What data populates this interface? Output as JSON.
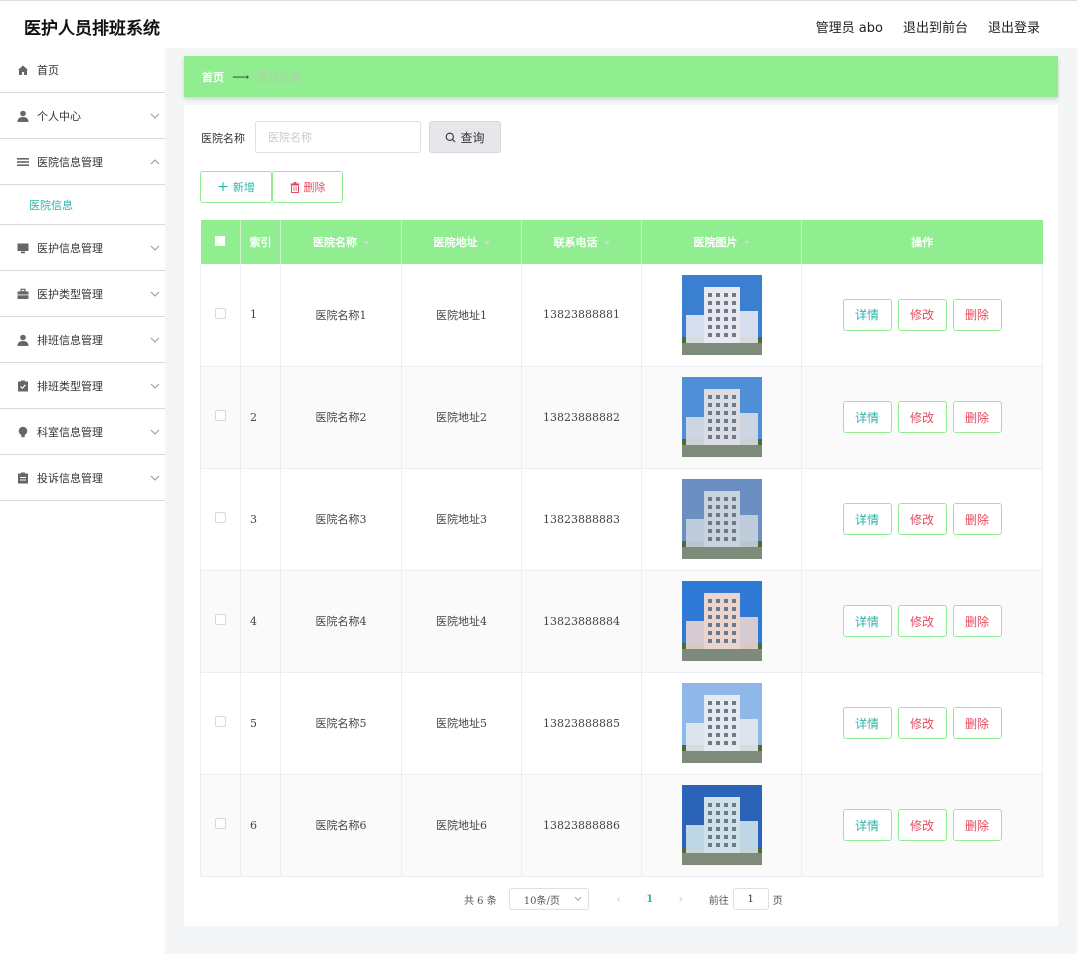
{
  "app": {
    "title": "医护人员排班系统"
  },
  "topbar": {
    "user_label": "管理员 abo",
    "front_label": "退出到前台",
    "logout_label": "退出登录"
  },
  "sidebar": {
    "home": "首页",
    "personal": "个人中心",
    "hospital_mgmt": "医院信息管理",
    "hospital_info": "医院信息",
    "nurse_mgmt": "医护信息管理",
    "nurse_type_mgmt": "医护类型管理",
    "schedule_mgmt": "排班信息管理",
    "schedule_type_mgmt": "排班类型管理",
    "dept_mgmt": "科室信息管理",
    "complaint_mgmt": "投诉信息管理"
  },
  "breadcrumb": {
    "home": "首页",
    "current": "医院信息"
  },
  "search": {
    "label": "医院名称",
    "placeholder": "医院名称",
    "value": "",
    "button": "查询"
  },
  "toolbar": {
    "add_label": "新增",
    "delete_label": "删除"
  },
  "table": {
    "headers": {
      "index": "索引",
      "name": "医院名称",
      "address": "医院地址",
      "phone": "联系电话",
      "photo": "医院图片",
      "actions": "操作"
    },
    "action_labels": {
      "detail": "详情",
      "edit": "修改",
      "delete": "删除"
    },
    "rows": [
      {
        "index": "1",
        "name": "医院名称1",
        "address": "医院地址1",
        "phone": "13823888881"
      },
      {
        "index": "2",
        "name": "医院名称2",
        "address": "医院地址2",
        "phone": "13823888882"
      },
      {
        "index": "3",
        "name": "医院名称3",
        "address": "医院地址3",
        "phone": "13823888883"
      },
      {
        "index": "4",
        "name": "医院名称4",
        "address": "医院地址4",
        "phone": "13823888884"
      },
      {
        "index": "5",
        "name": "医院名称5",
        "address": "医院地址5",
        "phone": "13823888885"
      },
      {
        "index": "6",
        "name": "医院名称6",
        "address": "医院地址6",
        "phone": "13823888886"
      }
    ]
  },
  "pagination": {
    "total": "共 6 条",
    "page_size": "10条/页",
    "current_page": "1",
    "goto_label": "前往",
    "goto_value": "1",
    "page_suffix": "页"
  },
  "colors": {
    "accent_green": "#90ee90",
    "teal": "#2bb5a6",
    "danger": "#e84a5f"
  }
}
